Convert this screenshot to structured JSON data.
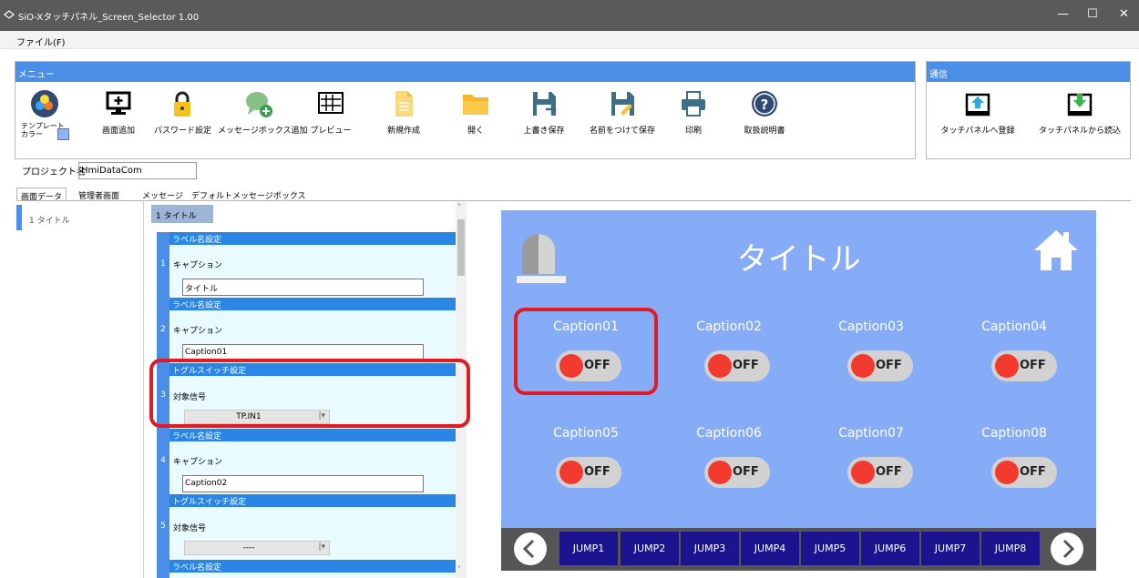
{
  "window": {
    "title": "SiO-Xタッチパネル_Screen_Selector 1.00",
    "minimize": "—",
    "maximize": "☐",
    "close": "✕"
  },
  "menubar": {
    "file": "ファイル(F)"
  },
  "menu_group": {
    "header": "メニュー",
    "tools": [
      {
        "label": "テンプレート\nカラー",
        "icon": "palette-icon"
      },
      {
        "label": "画面追加",
        "icon": "monitor-add-icon"
      },
      {
        "label": "パスワード設定",
        "icon": "lock-icon"
      },
      {
        "label": "メッセージボックス追加",
        "icon": "chat-add-icon"
      },
      {
        "label": "プレビュー",
        "icon": "grid-preview-icon"
      },
      {
        "label": "新規作成",
        "icon": "new-document-icon"
      },
      {
        "label": "開く",
        "icon": "folder-icon"
      },
      {
        "label": "上書き保存",
        "icon": "save-icon"
      },
      {
        "label": "名前をつけて保存",
        "icon": "save-as-icon"
      },
      {
        "label": "印刷",
        "icon": "printer-icon"
      },
      {
        "label": "取扱説明書",
        "icon": "help-icon"
      }
    ]
  },
  "comm_group": {
    "header": "通信",
    "tools": [
      {
        "label": "タッチパネルへ登録",
        "icon": "upload-icon"
      },
      {
        "label": "タッチパネルから読込",
        "icon": "download-icon"
      }
    ]
  },
  "project": {
    "label": "プロジェクト名",
    "value": "HmiDataCom"
  },
  "tabs": [
    "画面データ",
    "管理者画面",
    "メッセージ",
    "デフォルトメッセージボックス"
  ],
  "left_list": [
    "1 タイトル"
  ],
  "editor": {
    "header": "1 タイトル",
    "rows": [
      {
        "num": "1",
        "section": "ラベル名設定",
        "label": "キャプション",
        "value": "タイトル"
      },
      {
        "num": "2",
        "section": "ラベル名設定",
        "label": "キャプション",
        "value": "Caption01"
      },
      {
        "num": "3",
        "section": "トグルスイッチ設定",
        "label": "対象信号",
        "value": "TP.IN1"
      },
      {
        "num": "4",
        "section": "ラベル名設定",
        "label": "キャプション",
        "value": "Caption02"
      },
      {
        "num": "5",
        "section": "トグルスイッチ設定",
        "label": "対象信号",
        "value": "----"
      },
      {
        "section": "ラベル名設定"
      }
    ]
  },
  "preview": {
    "title": "タイトル",
    "background": "#86acf8",
    "captions": [
      "Caption01",
      "Caption02",
      "Caption03",
      "Caption04",
      "Caption05",
      "Caption06",
      "Caption07",
      "Caption08"
    ],
    "toggle_text": "OFF",
    "jumps": [
      "JUMP1",
      "JUMP2",
      "JUMP3",
      "JUMP4",
      "JUMP5",
      "JUMP6",
      "JUMP7",
      "JUMP8"
    ],
    "icons": [
      "alarm-lamp-icon",
      "home-icon",
      "prev-arrow-icon",
      "next-arrow-icon"
    ]
  },
  "colors": {
    "accent": "#4a8ee8",
    "highlight": "#e01b24",
    "toggle_knob": "#f23a2f",
    "jump_button": "#1b148e"
  }
}
